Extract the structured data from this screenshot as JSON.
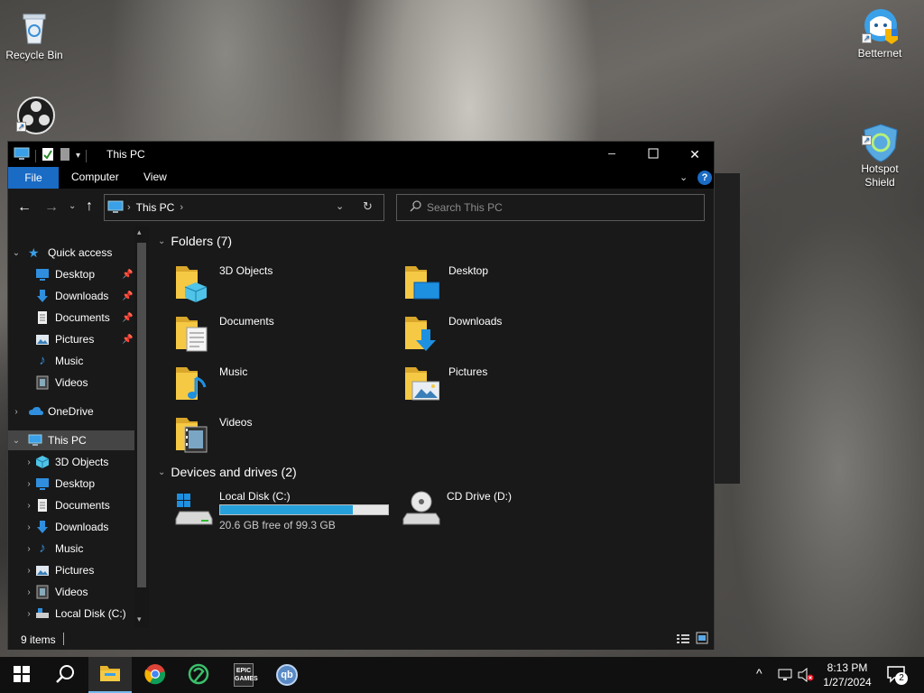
{
  "desktop": {
    "icons": [
      {
        "label": "Recycle Bin"
      },
      {
        "label": ""
      },
      {
        "label": "Betternet"
      },
      {
        "label": "Hotspot\nShield"
      }
    ]
  },
  "window": {
    "title": "This PC",
    "controls": {
      "minimize": "─",
      "maximize": "☐",
      "close": "✕"
    },
    "ribbon_tabs": [
      "File",
      "Computer",
      "View"
    ],
    "address": {
      "crumb": "This PC"
    },
    "search": {
      "placeholder": "Search This PC"
    },
    "nav": {
      "quick_access": "Quick access",
      "quick_items": [
        "Desktop",
        "Downloads",
        "Documents",
        "Pictures",
        "Music",
        "Videos"
      ],
      "onedrive": "OneDrive",
      "this_pc": "This PC",
      "pc_items": [
        "3D Objects",
        "Desktop",
        "Documents",
        "Downloads",
        "Music",
        "Pictures",
        "Videos",
        "Local Disk (C:)"
      ]
    },
    "folders_header": "Folders (7)",
    "folders": [
      "3D Objects",
      "Desktop",
      "Documents",
      "Downloads",
      "Music",
      "Pictures",
      "Videos"
    ],
    "devices_header": "Devices and drives (2)",
    "drives": [
      {
        "name": "Local Disk (C:)",
        "free_text": "20.6 GB free of 99.3 GB",
        "used_fraction": 0.79
      },
      {
        "name": "CD Drive (D:)"
      }
    ],
    "status": {
      "items": "9 items"
    }
  },
  "taskbar": {
    "time": "8:13 PM",
    "date": "1/27/2024",
    "notifications": "2",
    "apps": [
      "start",
      "search",
      "file-explorer",
      "chrome",
      "app-green",
      "epic-games",
      "qbittorrent"
    ],
    "epic_label": "EPIC\nGAMES",
    "qb_label": "qb"
  },
  "colors": {
    "accent": "#1a6bc4",
    "drive_fill": "#26a0da",
    "folder": "#f6c944"
  }
}
